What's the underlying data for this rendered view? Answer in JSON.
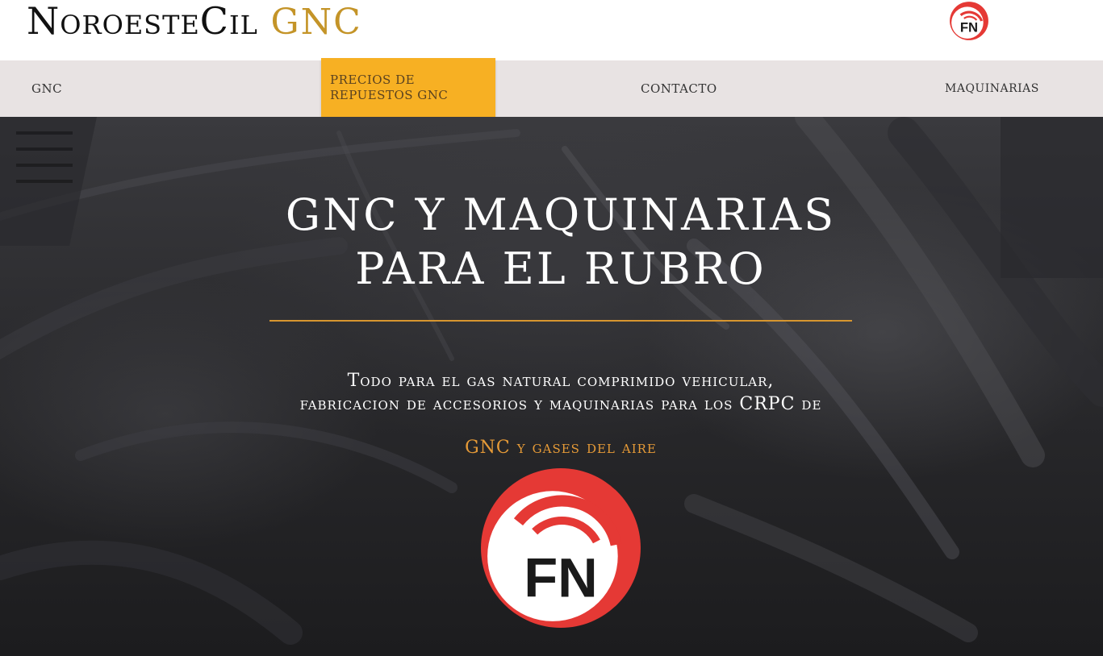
{
  "header": {
    "brand_main": "NoroesteCil",
    "brand_accent": "GNC",
    "logo_text": "FN"
  },
  "nav": {
    "items": [
      {
        "label": "GNC"
      },
      {
        "label": "PRECIOS DE REPUESTOS GNC",
        "active": true
      },
      {
        "label": "CONTACTO"
      },
      {
        "label": "MAQUINARIAS"
      }
    ]
  },
  "hero": {
    "title_line1": "GNC Y MAQUINARIAS",
    "title_line2": "PARA EL RUBRO",
    "text_line1": "Todo para el gas natural comprimido vehicular,",
    "text_line2": "fabricacion de accesorios y maquinarias para los CRPC de",
    "subtitle": "GNC y gases del aire",
    "logo_text": "FN"
  },
  "colors": {
    "accent_gold": "#c49428",
    "nav_active_bg": "#f7b023",
    "nav_bg": "#e8e3e3",
    "divider": "#d7962f",
    "subtitle": "#e59a37",
    "logo_red": "#e53935"
  }
}
